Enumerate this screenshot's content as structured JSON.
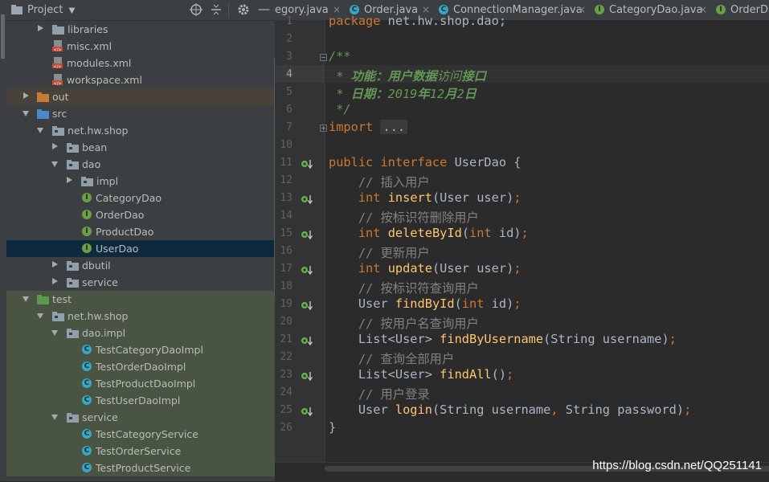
{
  "project_panel": {
    "title": "Project",
    "tree": [
      {
        "label": "libraries",
        "type": "folder",
        "depth": 2,
        "state": "collapsed"
      },
      {
        "label": "misc.xml",
        "type": "xml",
        "depth": 3,
        "state": "leaf"
      },
      {
        "label": "modules.xml",
        "type": "xml",
        "depth": 3,
        "state": "leaf"
      },
      {
        "label": "workspace.xml",
        "type": "xml",
        "depth": 3,
        "state": "leaf"
      },
      {
        "label": "out",
        "type": "folder-orange",
        "depth": 1,
        "state": "collapsed"
      },
      {
        "label": "src",
        "type": "folder-blue",
        "depth": 1,
        "state": "expanded"
      },
      {
        "label": "net.hw.shop",
        "type": "package",
        "depth": 2,
        "state": "expanded"
      },
      {
        "label": "bean",
        "type": "package",
        "depth": 3,
        "state": "collapsed"
      },
      {
        "label": "dao",
        "type": "package",
        "depth": 3,
        "state": "expanded"
      },
      {
        "label": "impl",
        "type": "package",
        "depth": 4,
        "state": "collapsed"
      },
      {
        "label": "CategoryDao",
        "type": "interface",
        "depth": 5,
        "state": "leaf"
      },
      {
        "label": "OrderDao",
        "type": "interface",
        "depth": 5,
        "state": "leaf"
      },
      {
        "label": "ProductDao",
        "type": "interface",
        "depth": 5,
        "state": "leaf"
      },
      {
        "label": "UserDao",
        "type": "interface",
        "depth": 5,
        "state": "leaf",
        "selected": true
      },
      {
        "label": "dbutil",
        "type": "package",
        "depth": 3,
        "state": "collapsed"
      },
      {
        "label": "service",
        "type": "package",
        "depth": 3,
        "state": "collapsed"
      },
      {
        "label": "test",
        "type": "folder-green",
        "depth": 1,
        "state": "expanded"
      },
      {
        "label": "net.hw.shop",
        "type": "package",
        "depth": 2,
        "state": "expanded"
      },
      {
        "label": "dao.impl",
        "type": "package",
        "depth": 3,
        "state": "expanded"
      },
      {
        "label": "TestCategoryDaoImpl",
        "type": "class",
        "depth": 5,
        "state": "leaf"
      },
      {
        "label": "TestOrderDaoImpl",
        "type": "class",
        "depth": 5,
        "state": "leaf"
      },
      {
        "label": "TestProductDaoImpl",
        "type": "class",
        "depth": 5,
        "state": "leaf"
      },
      {
        "label": "TestUserDaoImpl",
        "type": "class",
        "depth": 5,
        "state": "leaf"
      },
      {
        "label": "service",
        "type": "package",
        "depth": 3,
        "state": "expanded"
      },
      {
        "label": "TestCategoryService",
        "type": "class",
        "depth": 5,
        "state": "leaf"
      },
      {
        "label": "TestOrderService",
        "type": "class",
        "depth": 5,
        "state": "leaf"
      },
      {
        "label": "TestProductService",
        "type": "class",
        "depth": 5,
        "state": "leaf"
      }
    ]
  },
  "tabs": [
    {
      "label": "egory.java",
      "icon": "class-icon"
    },
    {
      "label": "Order.java",
      "icon": "class-icon"
    },
    {
      "label": "ConnectionManager.java",
      "icon": "class-icon"
    },
    {
      "label": "CategoryDao.java",
      "icon": "interface-icon"
    },
    {
      "label": "OrderDa",
      "icon": "interface-icon"
    }
  ],
  "editor": {
    "lines": [
      {
        "n": "1",
        "html": "<span class=\"kw\">package</span> net.hw.shop.dao;"
      },
      {
        "n": "2",
        "html": ""
      },
      {
        "n": "3",
        "html": "<span class=\"doc\">/**</span>"
      },
      {
        "n": "4",
        "html": "<span class=\"doc\"> * </span><span class=\"doctag\">功能：用户数据</span><span class=\"doc\">访问</span><span class=\"doctag\">接口</span>"
      },
      {
        "n": "5",
        "html": "<span class=\"doc\"> * </span><span class=\"doctag\">日期：</span><span class=\"doc\">2019</span><span class=\"doctag\">年</span><span class=\"doc\">12</span><span class=\"doctag\">月</span><span class=\"doc\">2</span><span class=\"doctag\">日</span>"
      },
      {
        "n": "6",
        "html": "<span class=\"doc\"> */</span>"
      },
      {
        "n": "7",
        "html": "<span class=\"kw\">import</span> <span class=\"fold\">...</span>"
      },
      {
        "n": "10",
        "html": ""
      },
      {
        "n": "11",
        "html": "<span class=\"kw\">public interface</span> UserDao {"
      },
      {
        "n": "12",
        "html": "    <span class=\"cmt\">// 插入用户</span>"
      },
      {
        "n": "13",
        "html": "    <span class=\"kw\">int</span> <span class=\"fn\">insert</span>(User user)<span class=\"kw\">;</span>"
      },
      {
        "n": "14",
        "html": "    <span class=\"cmt\">// 按标识符删除用户</span>"
      },
      {
        "n": "15",
        "html": "    <span class=\"kw\">int</span> <span class=\"fn\">deleteById</span>(<span class=\"kw\">int</span> id)<span class=\"kw\">;</span>"
      },
      {
        "n": "16",
        "html": "    <span class=\"cmt\">// 更新用户</span>"
      },
      {
        "n": "17",
        "html": "    <span class=\"kw\">int</span> <span class=\"fn\">update</span>(User user)<span class=\"kw\">;</span>"
      },
      {
        "n": "18",
        "html": "    <span class=\"cmt\">// 按标识符查询用户</span>"
      },
      {
        "n": "19",
        "html": "    User <span class=\"fn\">findById</span>(<span class=\"kw\">int</span> id)<span class=\"kw\">;</span>"
      },
      {
        "n": "20",
        "html": "    <span class=\"cmt\">// 按用户名查询用户</span>"
      },
      {
        "n": "21",
        "html": "    List&lt;User&gt; <span class=\"fn\">findByUsername</span>(String username)<span class=\"kw\">;</span>"
      },
      {
        "n": "22",
        "html": "    <span class=\"cmt\">// 查询全部用户</span>"
      },
      {
        "n": "23",
        "html": "    List&lt;User&gt; <span class=\"fn\">findAll</span>()<span class=\"kw\">;</span>"
      },
      {
        "n": "24",
        "html": "    <span class=\"cmt\">// 用户登录</span>"
      },
      {
        "n": "25",
        "html": "    User <span class=\"fn\">login</span>(String username<span class=\"kw\">,</span> String password)<span class=\"kw\">;</span>"
      },
      {
        "n": "26",
        "html": "}"
      }
    ],
    "implemented_lines": [
      "11",
      "13",
      "15",
      "17",
      "19",
      "21",
      "23",
      "25"
    ],
    "fold_lines": [
      "3",
      "7"
    ],
    "caret_line": "4"
  },
  "watermark": "https://blog.csdn.net/QQ251141",
  "colors": {
    "keyword": "#cc7832",
    "method": "#ffc66d",
    "doc": "#629755",
    "comment": "#808080",
    "selection": "#0d293e"
  }
}
